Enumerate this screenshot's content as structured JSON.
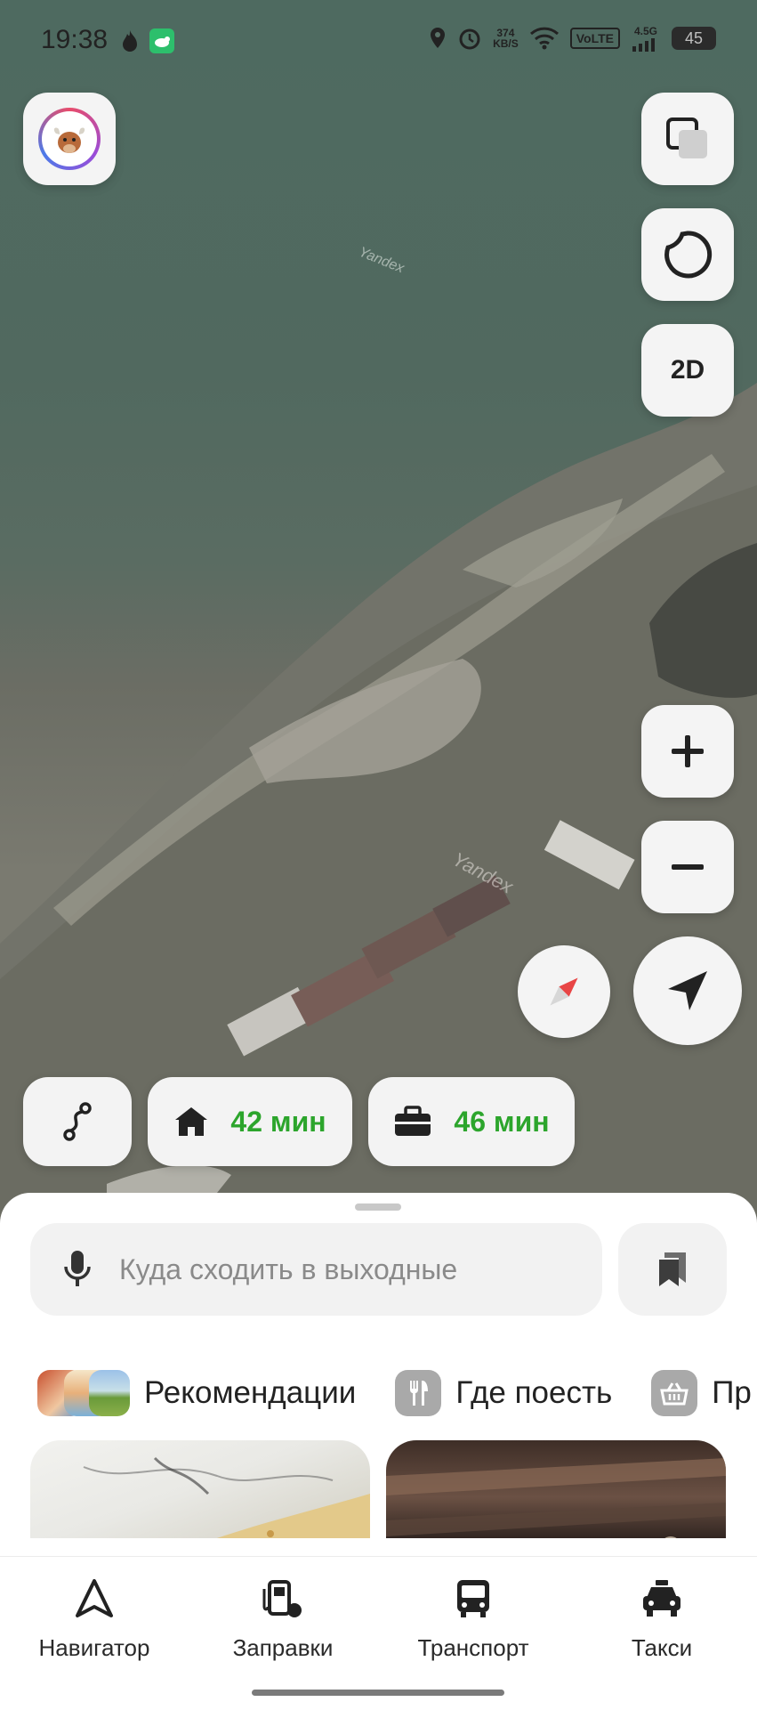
{
  "status_bar": {
    "time": "19:38",
    "net_speed": "374\nKB/S",
    "volte": "VoLTE",
    "network": "4.5G",
    "battery": "45"
  },
  "map": {
    "watermark": "Yandex",
    "layers_icon": "layers-icon",
    "style_icon": "map-style-icon",
    "mode_label": "2D",
    "zoom_in": "+",
    "zoom_out": "−"
  },
  "shortcuts": {
    "home_time": "42 мин",
    "work_time": "46 мин"
  },
  "search": {
    "placeholder": "Куда сходить в выходные"
  },
  "categories": [
    {
      "label": "Рекомендации"
    },
    {
      "label": "Где поесть"
    },
    {
      "label": "Пр"
    }
  ],
  "bottom_nav": [
    {
      "label": "Навигатор",
      "icon": "navigator-icon"
    },
    {
      "label": "Заправки",
      "icon": "gas-station-icon"
    },
    {
      "label": "Транспорт",
      "icon": "bus-icon"
    },
    {
      "label": "Такси",
      "icon": "taxi-icon"
    }
  ],
  "colors": {
    "accent_green": "#2ca52c",
    "compass_red": "#e84545"
  }
}
